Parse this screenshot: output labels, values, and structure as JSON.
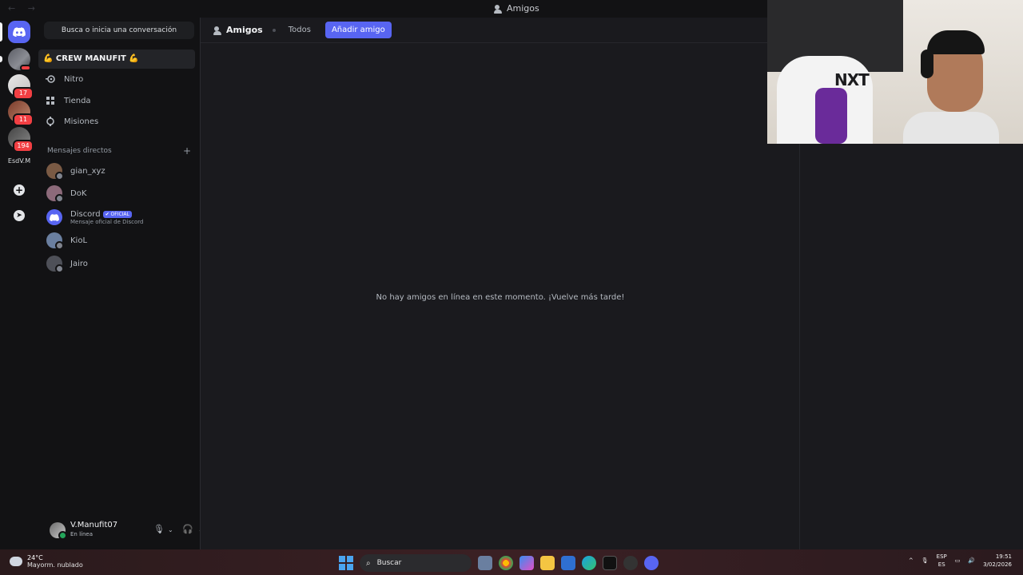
{
  "window": {
    "nav_arrows": "←  →",
    "title": "Amigos"
  },
  "server_rail": {
    "servers": [
      {
        "name": "discord-home"
      },
      {
        "name": "server-1",
        "badge": ""
      },
      {
        "name": "server-2",
        "badge": "17"
      },
      {
        "name": "server-3",
        "badge": "11"
      },
      {
        "name": "server-4",
        "badge": "194"
      }
    ],
    "folder_label": "EsdV.M"
  },
  "sidebar": {
    "search_placeholder": "Busca o inicia una conversación",
    "tooltip": "💪 CREW MANUFIT 💪",
    "nav_items": [
      {
        "label": "Nitro",
        "icon": "nitro-icon"
      },
      {
        "label": "Tienda",
        "icon": "shop-icon"
      },
      {
        "label": "Misiones",
        "icon": "quests-icon"
      }
    ],
    "dm_section_title": "Mensajes directos",
    "dm_add": "+",
    "dms": [
      {
        "name": "gian_xyz",
        "color": "#7a5a44"
      },
      {
        "name": "DoK",
        "color": "#8c6a7a"
      },
      {
        "name": "Discord",
        "tag": "✔ OFICIAL",
        "subtitle": "Mensaje oficial de Discord",
        "color": "#5865f2"
      },
      {
        "name": "KioL",
        "color": "#6a7fa0"
      },
      {
        "name": "Jairo",
        "color": "#4e5058"
      }
    ]
  },
  "user_panel": {
    "username": "V.Manufit07",
    "status": "En línea"
  },
  "main": {
    "tab_title": "Amigos",
    "tabs": [
      "Todos"
    ],
    "add_friend": "Añadir amigo",
    "empty_message": "No hay amigos en línea en este momento. ¡Vuelve más tarde!"
  },
  "webcam": {
    "chair_text": "NXT"
  },
  "taskbar": {
    "temperature": "24°C",
    "weather": "Mayorm. nublado",
    "search_label": "Buscar",
    "lang_1": "ESP",
    "lang_2": "ES",
    "time": "19:51",
    "date": "3/02/2026"
  },
  "colors": {
    "accent": "#5865f2",
    "background": "#1a1a1e",
    "sidebar": "#121214",
    "danger": "#f23f43",
    "online": "#23a55a"
  }
}
